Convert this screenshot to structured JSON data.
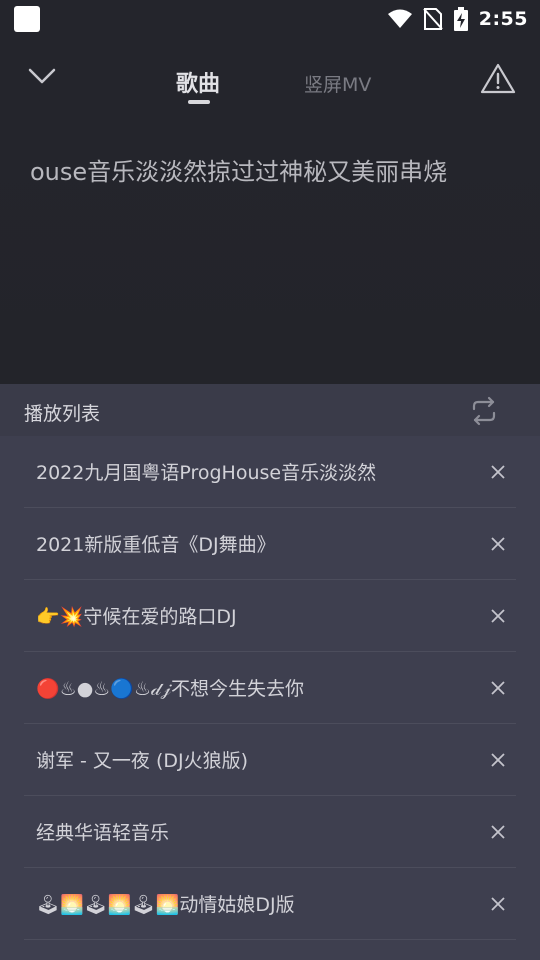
{
  "status_bar": {
    "time": "2:55",
    "icons": [
      "app-square-icon",
      "wifi-icon",
      "no-sim-icon",
      "battery-charging-icon"
    ]
  },
  "header": {
    "tabs": [
      {
        "label": "歌曲",
        "active": true
      },
      {
        "label": "竖屏MV",
        "active": false
      }
    ],
    "icons": [
      "chevron-down-icon",
      "warning-icon"
    ]
  },
  "now_playing": {
    "scrolling_title": "ouse音乐淡淡然掠过过神秘又美丽串烧"
  },
  "playlist": {
    "title": "播放列表",
    "icon": "repeat-icon",
    "items": [
      {
        "label": "2022九月国粤语ProgHouse音乐淡淡然"
      },
      {
        "label": "2021新版重低音《DJ舞曲》"
      },
      {
        "label": "👉💥守候在爱的路口DJ"
      },
      {
        "label": "🔴♨●♨🔵♨𝒹𝒿不想今生失去你"
      },
      {
        "label": "谢军 - 又一夜 (DJ火狼版)"
      },
      {
        "label": "经典华语轻音乐"
      },
      {
        "label": "🕹🌅🕹🌅🕹🌅动情姑娘DJ版"
      }
    ]
  },
  "colors": {
    "background": "#23242b",
    "sheet": "#3e3f4f",
    "sheet_header": "#3a3b49"
  }
}
